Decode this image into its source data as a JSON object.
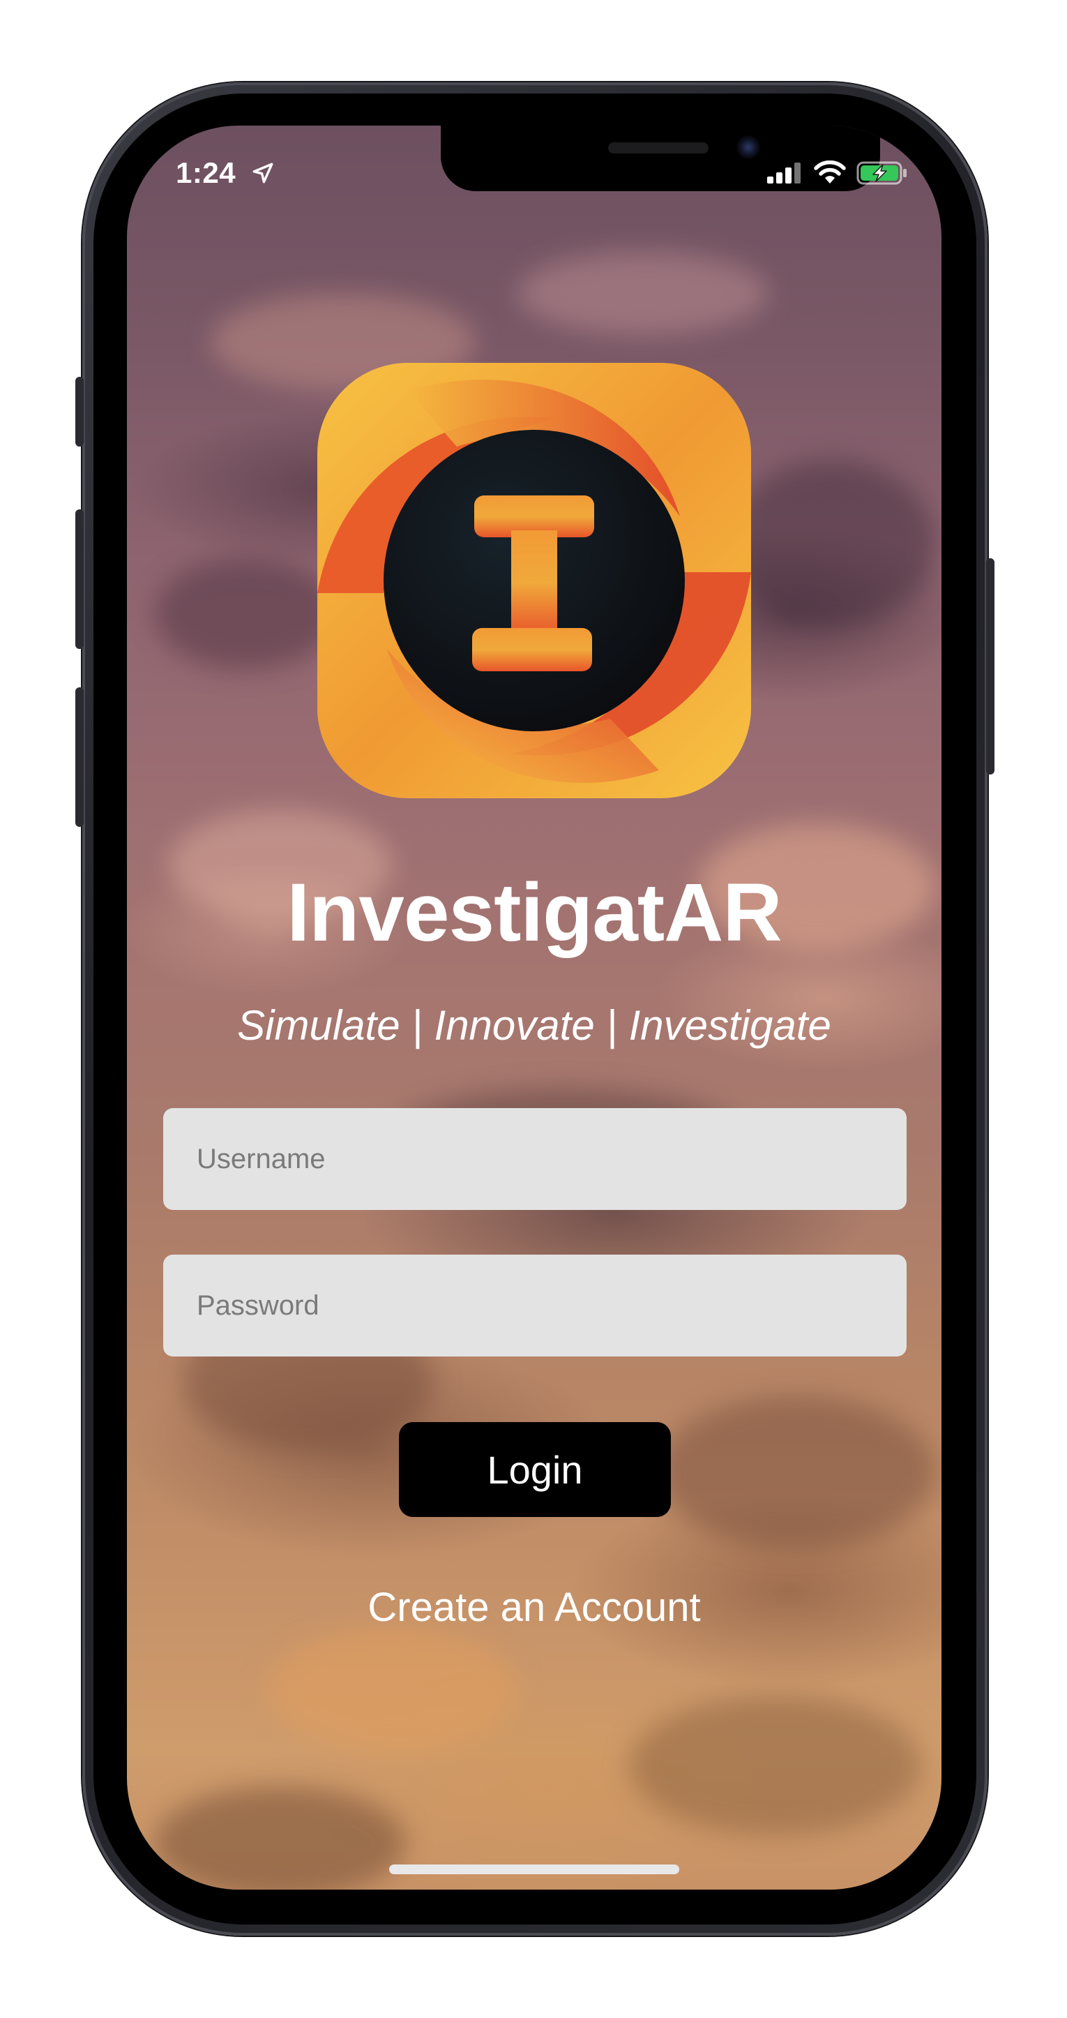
{
  "status_bar": {
    "time": "1:24",
    "location_icon": "location-arrow-icon",
    "signal_icon": "cellular-signal-icon",
    "wifi_icon": "wifi-icon",
    "battery_icon": "battery-charging-icon",
    "battery_color": "#34c759"
  },
  "app": {
    "logo_icon": "investigatar-logo-icon",
    "name": "InvestigatAR",
    "tagline": "Simulate | Innovate | Investigate"
  },
  "login_form": {
    "username_placeholder": "Username",
    "username_value": "",
    "password_placeholder": "Password",
    "password_value": "",
    "login_label": "Login",
    "create_account_label": "Create an Account"
  },
  "colors": {
    "logo_yellow": "#f7c244",
    "logo_orange": "#ee7a2a",
    "logo_red": "#e2462a",
    "logo_dark": "#0f1418",
    "button_bg": "#000000",
    "field_bg": "#e3e3e3"
  }
}
